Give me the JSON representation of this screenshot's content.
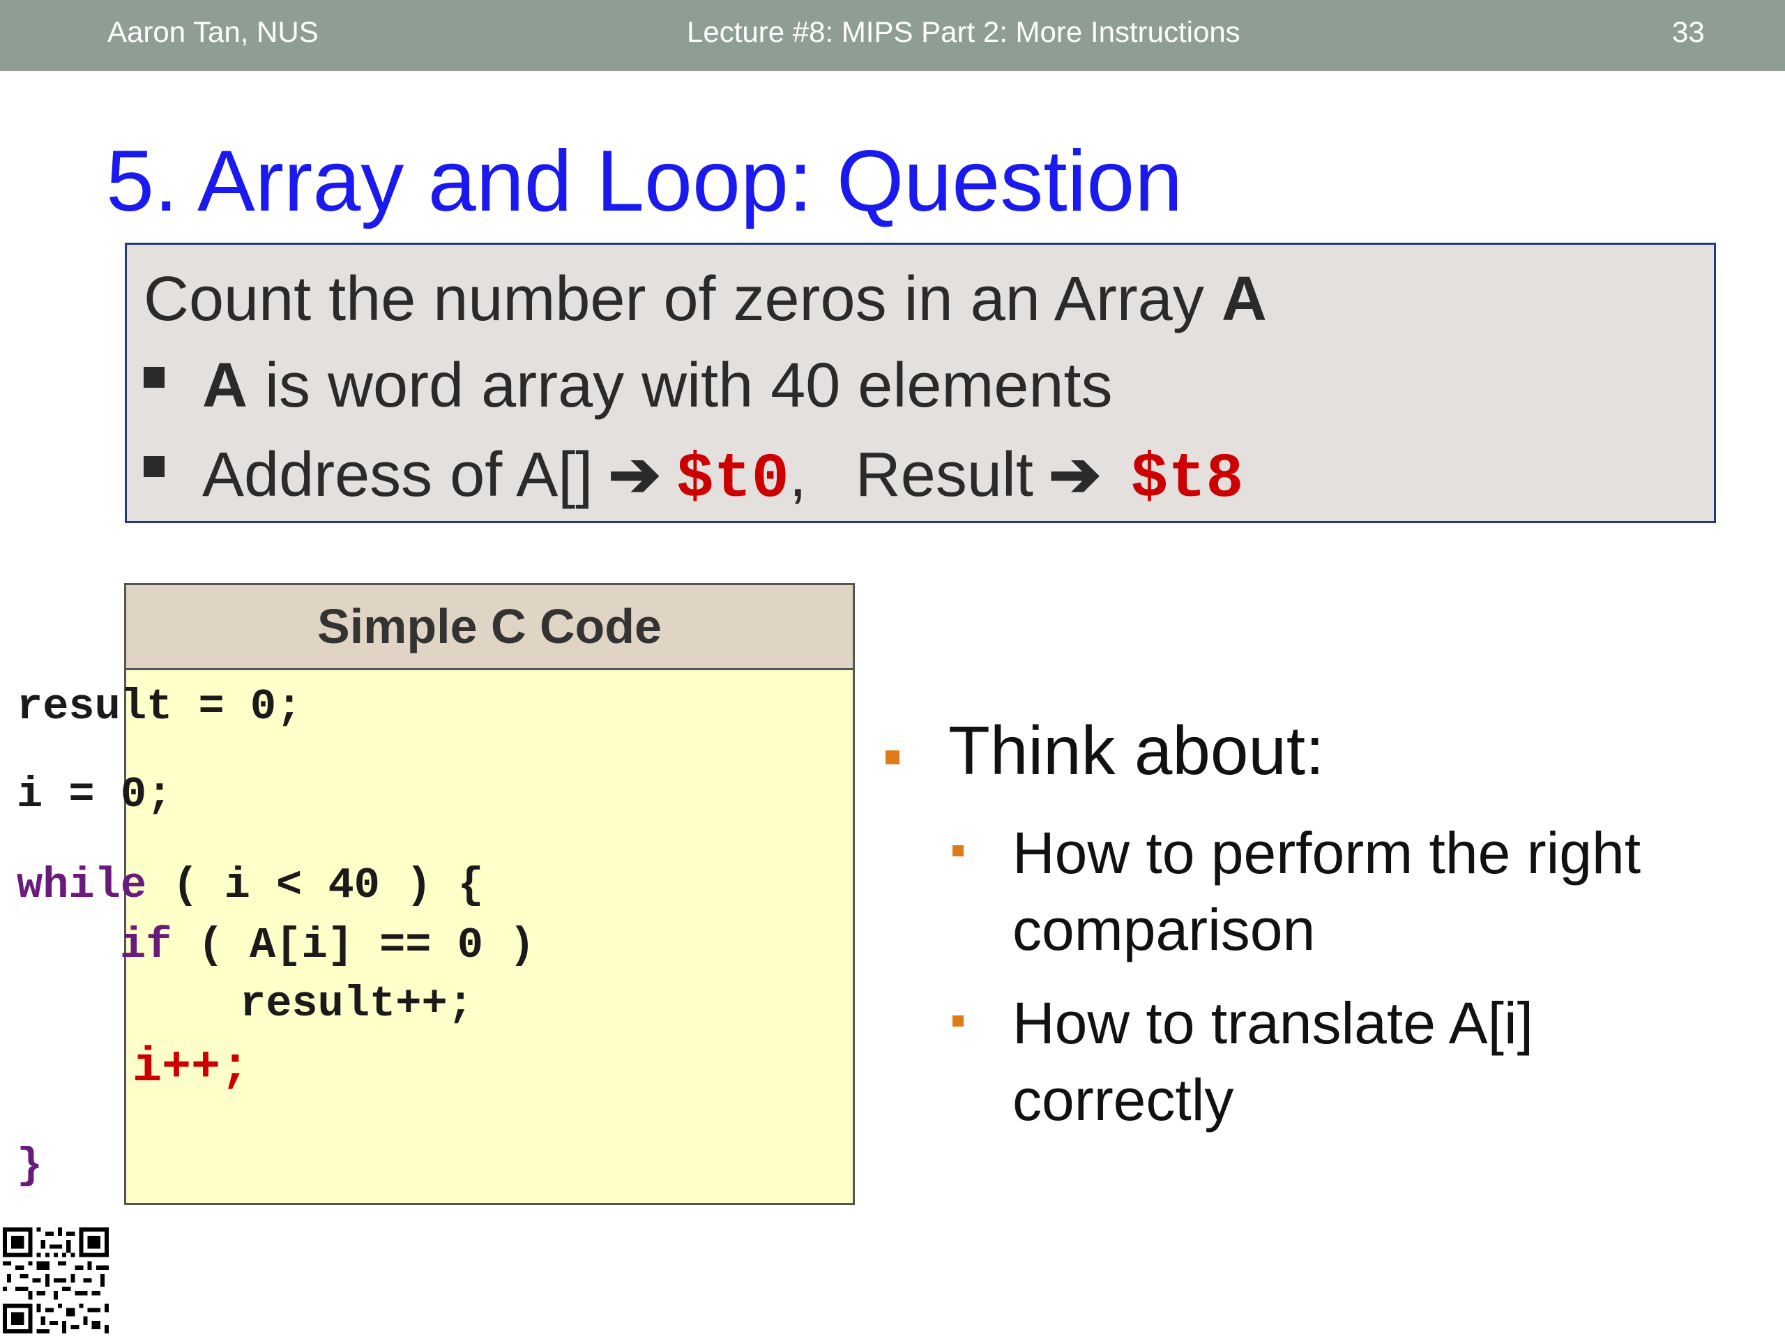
{
  "header": {
    "author": "Aaron Tan, NUS",
    "lecture": "Lecture #8: MIPS Part 2: More Instructions",
    "page_number": "33"
  },
  "title": "5. Array and Loop: Question",
  "question": {
    "heading_prefix": "Count the number of zeros in an Array ",
    "heading_array": "A",
    "bullet1_bold": "A",
    "bullet1_rest": " is word array with 40 elements",
    "bullet2_text1": "Address of A[]",
    "bullet2_arrow": "➔",
    "bullet2_reg1": "$t0",
    "bullet2_comma": ",",
    "bullet2_text2": "Result",
    "bullet2_reg2": "$t8"
  },
  "code": {
    "header": "Simple C Code",
    "line1": "result = 0;",
    "line2": "i = 0;",
    "line3_kw": "while",
    "line3_rest": " ( i < 40 ) {",
    "line4_kw": "if",
    "line4_rest": " ( A[i] == 0 )",
    "line5": "result++;",
    "line6": "i++;",
    "line7": "}"
  },
  "think": {
    "heading": "Think about:",
    "items": [
      "How to perform the right comparison",
      "How to translate A[i] correctly"
    ]
  },
  "colors": {
    "header_bg": "#8f9e93",
    "title": "#1a1aee",
    "register": "#cc0000",
    "keyword": "#6a1a7a",
    "bullet": "#e07b1a"
  }
}
